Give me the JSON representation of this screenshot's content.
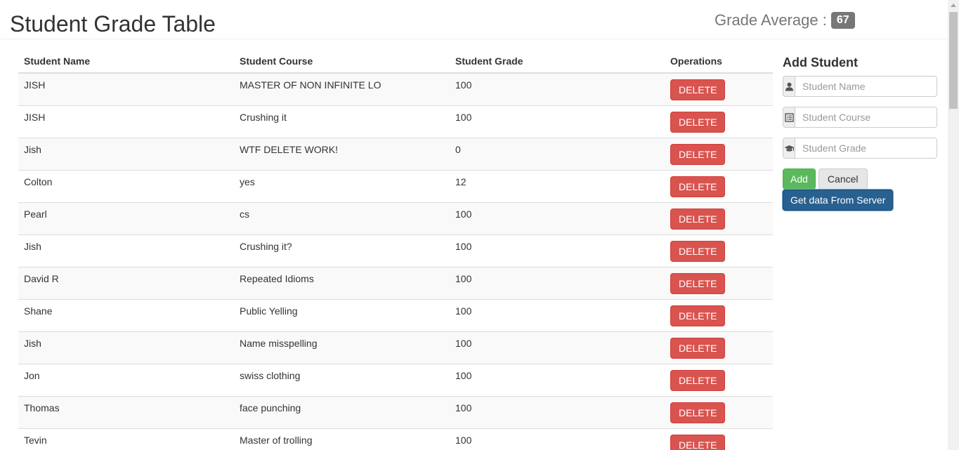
{
  "header": {
    "title": "Student Grade Table",
    "grade_average_label": "Grade Average :",
    "grade_average_value": "67"
  },
  "table": {
    "columns": [
      "Student Name",
      "Student Course",
      "Student Grade",
      "Operations"
    ],
    "delete_label": "DELETE",
    "rows": [
      {
        "name": "JISH",
        "course": "MASTER OF NON INFINITE LO",
        "grade": "100"
      },
      {
        "name": "JISH",
        "course": "Crushing it",
        "grade": "100"
      },
      {
        "name": "Jish",
        "course": "WTF DELETE WORK!",
        "grade": "0"
      },
      {
        "name": "Colton",
        "course": "yes",
        "grade": "12"
      },
      {
        "name": "Pearl",
        "course": "cs",
        "grade": "100"
      },
      {
        "name": "Jish",
        "course": "Crushing it?",
        "grade": "100"
      },
      {
        "name": "David R",
        "course": "Repeated Idioms",
        "grade": "100"
      },
      {
        "name": "Shane",
        "course": "Public Yelling",
        "grade": "100"
      },
      {
        "name": "Jish",
        "course": "Name misspelling",
        "grade": "100"
      },
      {
        "name": "Jon",
        "course": "swiss clothing",
        "grade": "100"
      },
      {
        "name": "Thomas",
        "course": "face punching",
        "grade": "100"
      },
      {
        "name": "Tevin",
        "course": "Master of trolling",
        "grade": "100"
      }
    ]
  },
  "add_form": {
    "title": "Add Student",
    "name_placeholder": "Student Name",
    "course_placeholder": "Student Course",
    "grade_placeholder": "Student Grade",
    "name_icon": "user-icon",
    "course_icon": "list-alt-icon",
    "grade_icon": "education-icon",
    "add_label": "Add",
    "cancel_label": "Cancel",
    "server_label": "Get data From Server"
  },
  "colors": {
    "delete": "#d9534f",
    "add": "#5cb85c",
    "primary": "#286090",
    "badge": "#777777"
  }
}
